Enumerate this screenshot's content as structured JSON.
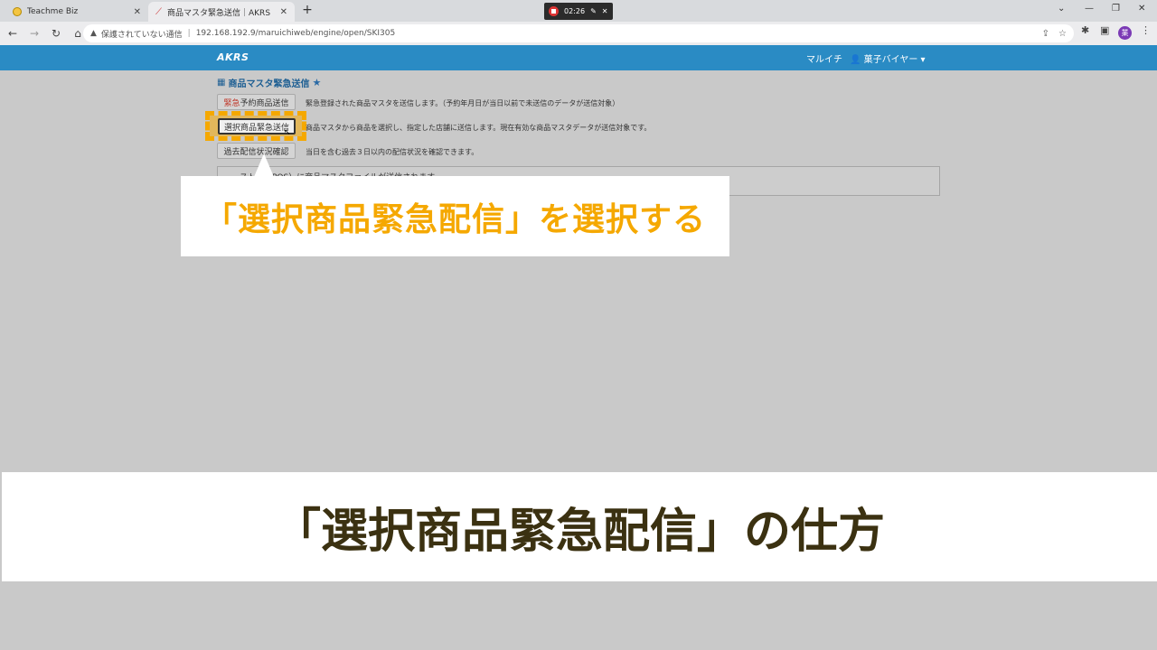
{
  "browser": {
    "tabs": [
      {
        "title": "Teachme Biz",
        "active": false
      },
      {
        "title": "商品マスタ緊急送信｜AKRS",
        "active": true
      }
    ],
    "recording_time": "02:26",
    "address": {
      "security_label": "保護されていない通信",
      "url": "192.168.192.9/maruichiweb/engine/open/SKI305"
    },
    "profile_initial": "業"
  },
  "app": {
    "brand": "AKRS",
    "company": "マルイチ",
    "user": "菓子バイヤー",
    "page_title": "商品マスタ緊急送信",
    "functions": [
      {
        "label_prefix": "緊急",
        "label_rest": "予約商品送信",
        "description": "緊急登録された商品マスタを送信します。（予約年月日が当日以前で未送信のデータが送信対象）"
      },
      {
        "label_prefix": "選択",
        "label_rest": "商品緊急送信",
        "description": "商品マスタから商品を選択し、指定した店舗に送信します。現在有効な商品マスタデータが送信対象です。"
      },
      {
        "label": "過去配信状況確認",
        "description": "当日を含む過去３日以内の配信状況を確認できます。"
      }
    ],
    "panel_text": "ストア（POS）に商品マスタファイルが送信されます。"
  },
  "overlay": {
    "callout": "「選択商品緊急配信」を選択する",
    "caption": "「選択商品緊急配信」の仕方",
    "highlight_color": "#f5a800"
  }
}
